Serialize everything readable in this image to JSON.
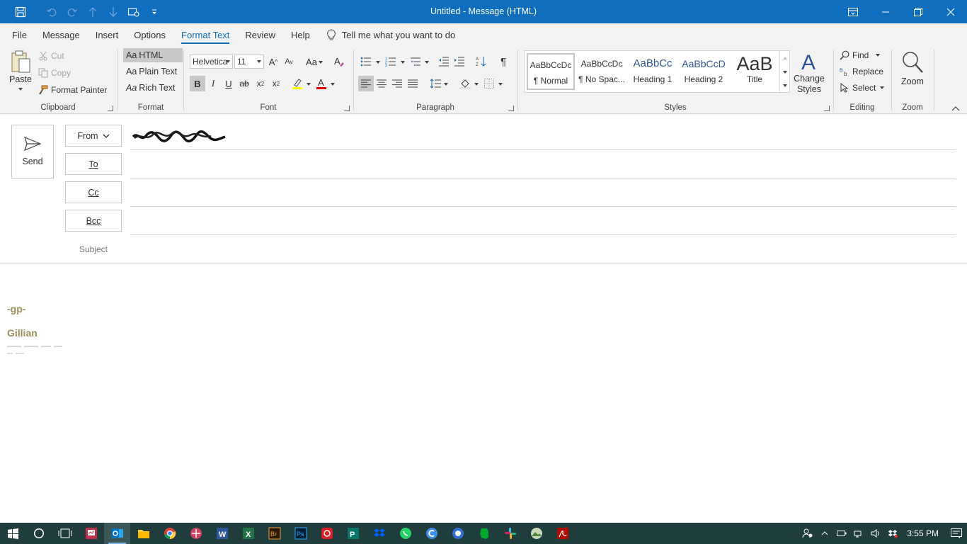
{
  "window": {
    "title": "Untitled  -  Message (HTML)",
    "accent": "#106ebe"
  },
  "tabs": [
    {
      "label": "File"
    },
    {
      "label": "Message"
    },
    {
      "label": "Insert"
    },
    {
      "label": "Options"
    },
    {
      "label": "Format Text",
      "active": true
    },
    {
      "label": "Review"
    },
    {
      "label": "Help"
    }
  ],
  "tell_me": "Tell me what you want to do",
  "clipboard": {
    "paste": "Paste",
    "cut": "Cut",
    "copy": "Copy",
    "format_painter": "Format Painter",
    "group": "Clipboard"
  },
  "format": {
    "html": "HTML",
    "plain": "Plain Text",
    "rich": "Rich Text",
    "prefix": "Aa",
    "group": "Format"
  },
  "font": {
    "name": "Helvetica",
    "size": "11",
    "case_label": "Aa",
    "group": "Font"
  },
  "paragraph": {
    "group": "Paragraph"
  },
  "styles": {
    "items": [
      {
        "sample": "AaBbCcDc",
        "name": "¶ Normal"
      },
      {
        "sample": "AaBbCcDc",
        "name": "¶ No Spac..."
      },
      {
        "sample": "AaBbCc",
        "name": "Heading 1"
      },
      {
        "sample": "AaBbCcD",
        "name": "Heading 2"
      },
      {
        "sample": "AaB",
        "name": "Title"
      }
    ],
    "change_styles": "Change Styles",
    "group": "Styles"
  },
  "editing": {
    "find": "Find",
    "replace": "Replace",
    "select": "Select",
    "group": "Editing"
  },
  "zoom": {
    "label": "Zoom",
    "group": "Zoom"
  },
  "compose": {
    "send": "Send",
    "from": "From",
    "to": "To",
    "cc": "Cc",
    "bcc": "Bcc",
    "subject": "Subject",
    "to_value": "",
    "cc_value": "",
    "bcc_value": "",
    "subject_value": ""
  },
  "body": {
    "sig_initials": "-gp-",
    "sig_name": "Gillian"
  },
  "taskbar": {
    "time": "3:55 PM",
    "color": "#1f3d3d"
  }
}
